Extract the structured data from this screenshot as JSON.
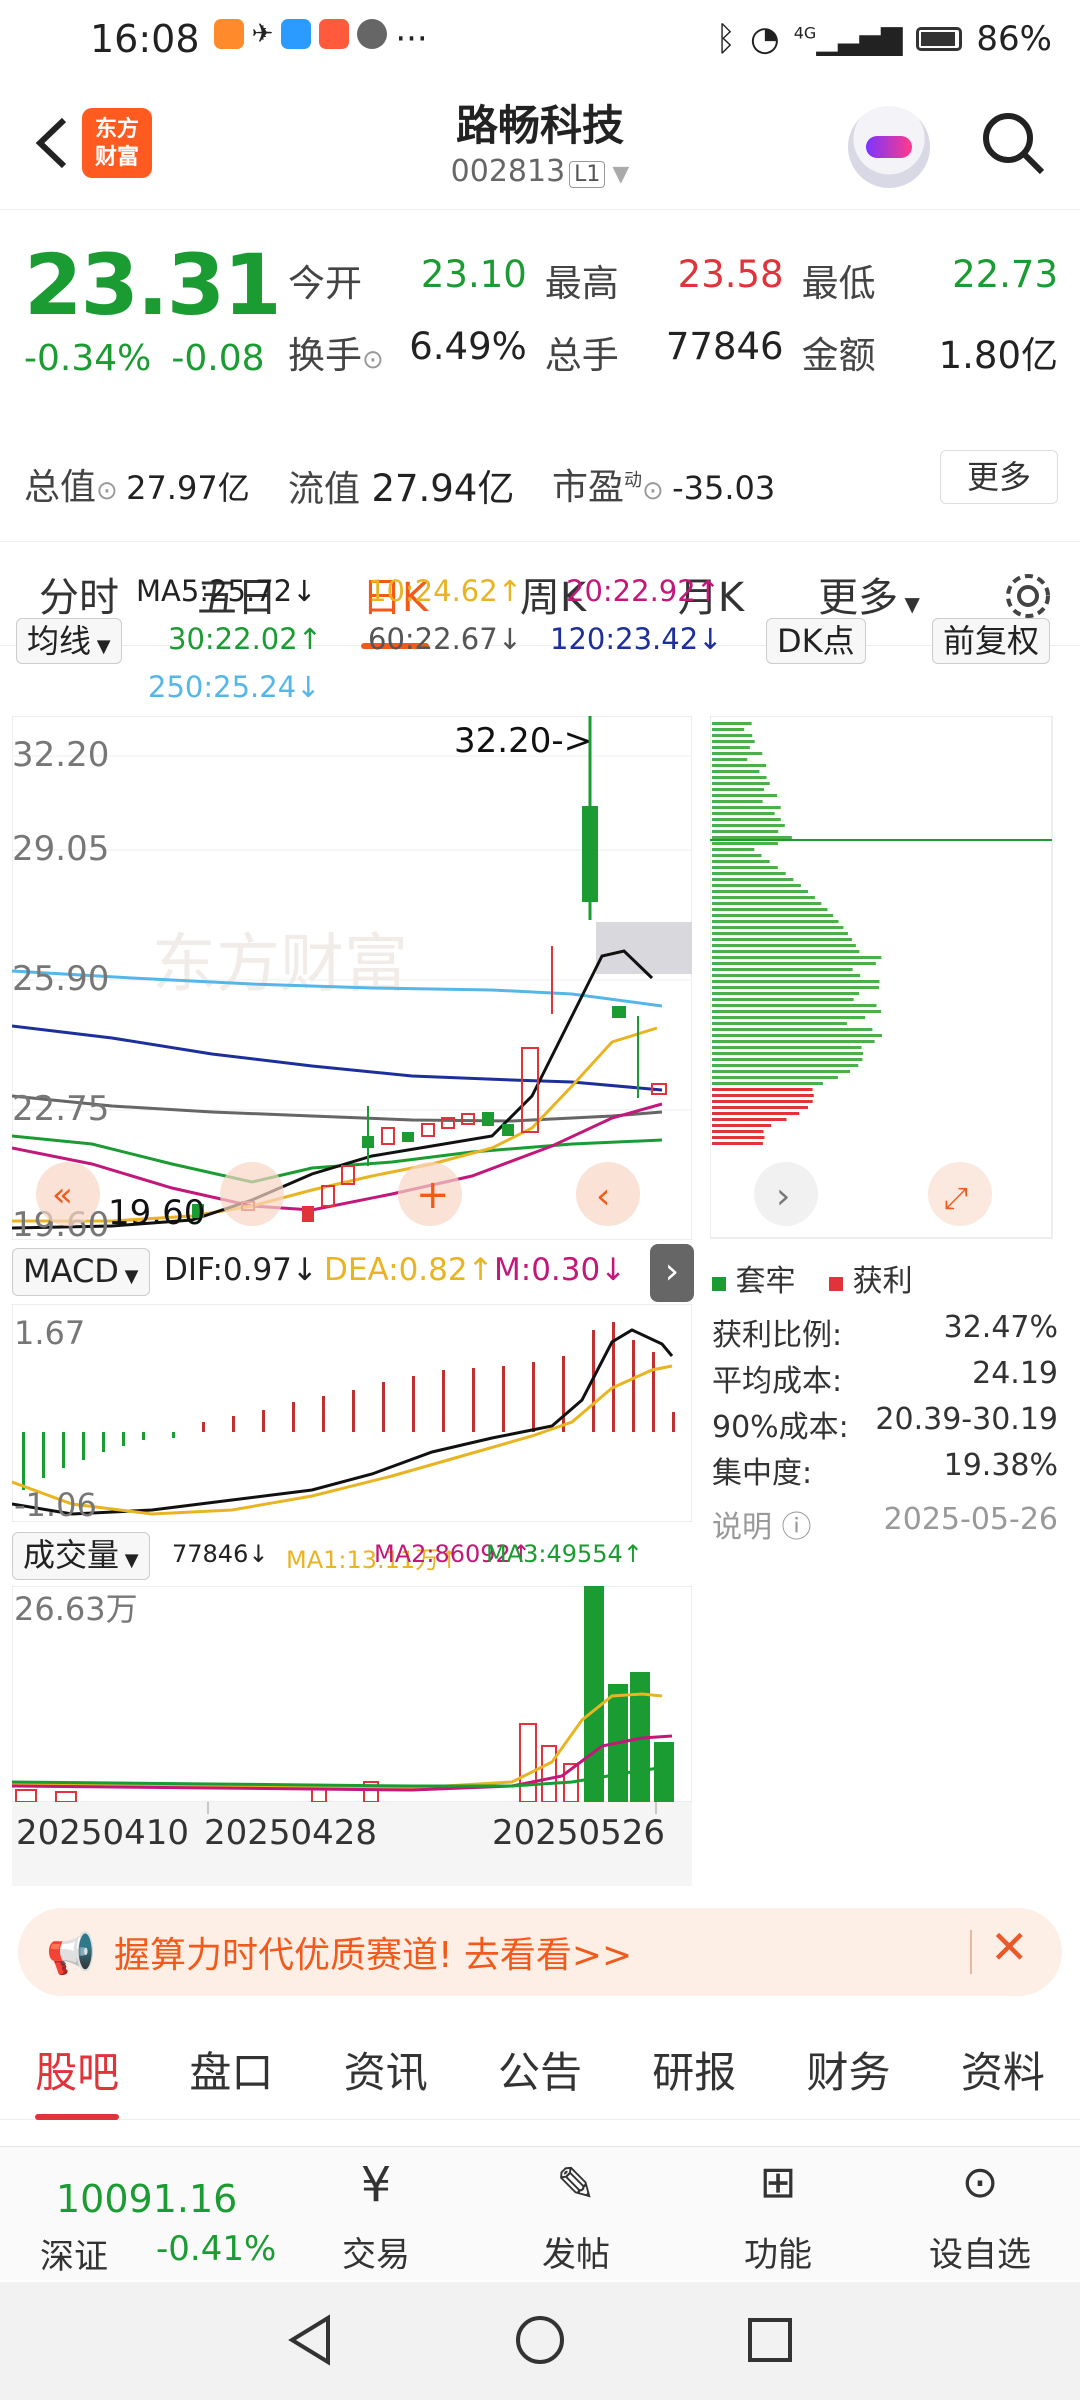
{
  "status": {
    "time": "16:08",
    "battery": "86%",
    "net": "4G"
  },
  "header": {
    "logo_l1": "东方",
    "logo_l2": "财富",
    "title": "路畅科技",
    "code": "002813",
    "level": "L1"
  },
  "quote": {
    "price": "23.31",
    "pct": "-0.34%",
    "chg": "-0.08",
    "open_label": "今开",
    "open": "23.10",
    "high_label": "最高",
    "high": "23.58",
    "low_label": "最低",
    "low": "22.73",
    "turnover_label": "换手",
    "turnover": "6.49%",
    "volume_label": "总手",
    "volume": "77846",
    "amount_label": "金额",
    "amount": "1.80亿",
    "mcap_label": "总值",
    "mcap": "27.97亿",
    "float_label": "流值",
    "float": "27.94亿",
    "pe_label": "市盈",
    "pe_sup": "动",
    "pe": "-35.03",
    "more": "更多"
  },
  "period_tabs": [
    "分时",
    "五日",
    "日K",
    "周K",
    "月K",
    "更多"
  ],
  "ma_legend": {
    "ma5": "MA5:25.72↓",
    "ma10": "10:24.62↑",
    "ma20": "20:22.92↑",
    "ma30": "30:22.02↑",
    "ma60": "60:22.67↓",
    "ma120": "120:23.42↓",
    "ma250": "250:25.24↓",
    "junxian": "均线",
    "dk": "DK点",
    "fq": "前复权"
  },
  "kline": {
    "y_labels": [
      "32.20",
      "29.05",
      "25.90",
      "22.75",
      "19.60"
    ],
    "max_note": "32.20->",
    "min_note": "19.60",
    "watermark": "东方财富"
  },
  "macd": {
    "label": "MACD",
    "dif": "DIF:0.97↓",
    "dea": "DEA:0.82↑",
    "m": "M:0.30↓",
    "y_top": "1.67",
    "y_bottom": "-1.06"
  },
  "volume": {
    "label": "成交量",
    "vol": "77846↓",
    "ma1": "MA1:13.11万↑",
    "ma2": "MA2:86092↑",
    "ma3": "MA3:49554↑",
    "y_top": "26.63万"
  },
  "dates": [
    "20250410",
    "20250428",
    "20250526"
  ],
  "chip": {
    "legend_trap": "套牢",
    "legend_profit": "获利",
    "rows": [
      {
        "label": "获利比例:",
        "value": "32.47%"
      },
      {
        "label": "平均成本:",
        "value": "24.19"
      },
      {
        "label": "90%成本:",
        "value": "20.39-30.19"
      },
      {
        "label": "集中度:",
        "value": "19.38%"
      }
    ],
    "note": "说明",
    "date": "2025-05-26"
  },
  "banner": "握算力时代优质赛道! 去看看>>",
  "bottom_tabs": [
    "股吧",
    "盘口",
    "资讯",
    "公告",
    "研报",
    "财务",
    "资料"
  ],
  "dock": {
    "index_value": "10091.16",
    "index_name": "深证",
    "index_pct": "-0.41%",
    "trade": "交易",
    "post": "发帖",
    "func": "功能",
    "watch": "设自选"
  },
  "colors": {
    "up": "#e0333a",
    "down": "#1a9c32",
    "accent": "#f25a1b"
  }
}
